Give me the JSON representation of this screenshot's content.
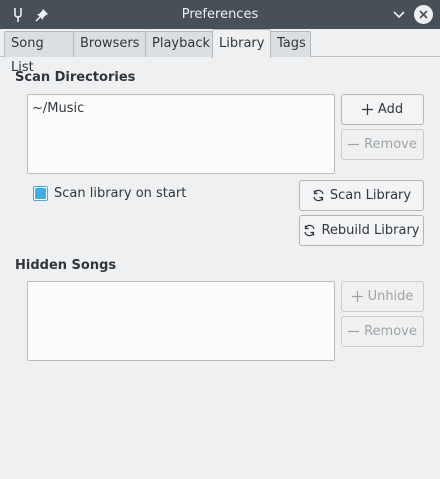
{
  "window": {
    "title": "Preferences"
  },
  "tabs": [
    {
      "label": "Song List"
    },
    {
      "label": "Browsers"
    },
    {
      "label": "Playback"
    },
    {
      "label": "Library"
    },
    {
      "label": "Tags"
    }
  ],
  "active_tab": "Library",
  "scan": {
    "title": "Scan Directories",
    "directories": [
      "~/Music"
    ],
    "add_label": "Add",
    "remove_label": "Remove",
    "scan_on_start_label": "Scan library on start",
    "scan_on_start_checked": true,
    "scan_library_label": "Scan Library",
    "rebuild_library_label": "Rebuild Library"
  },
  "hidden": {
    "title": "Hidden Songs",
    "unhide_label": "Unhide",
    "remove_label": "Remove"
  },
  "colors": {
    "accent": "#3daee9",
    "titlebar": "#475057",
    "background": "#eff0f1"
  }
}
